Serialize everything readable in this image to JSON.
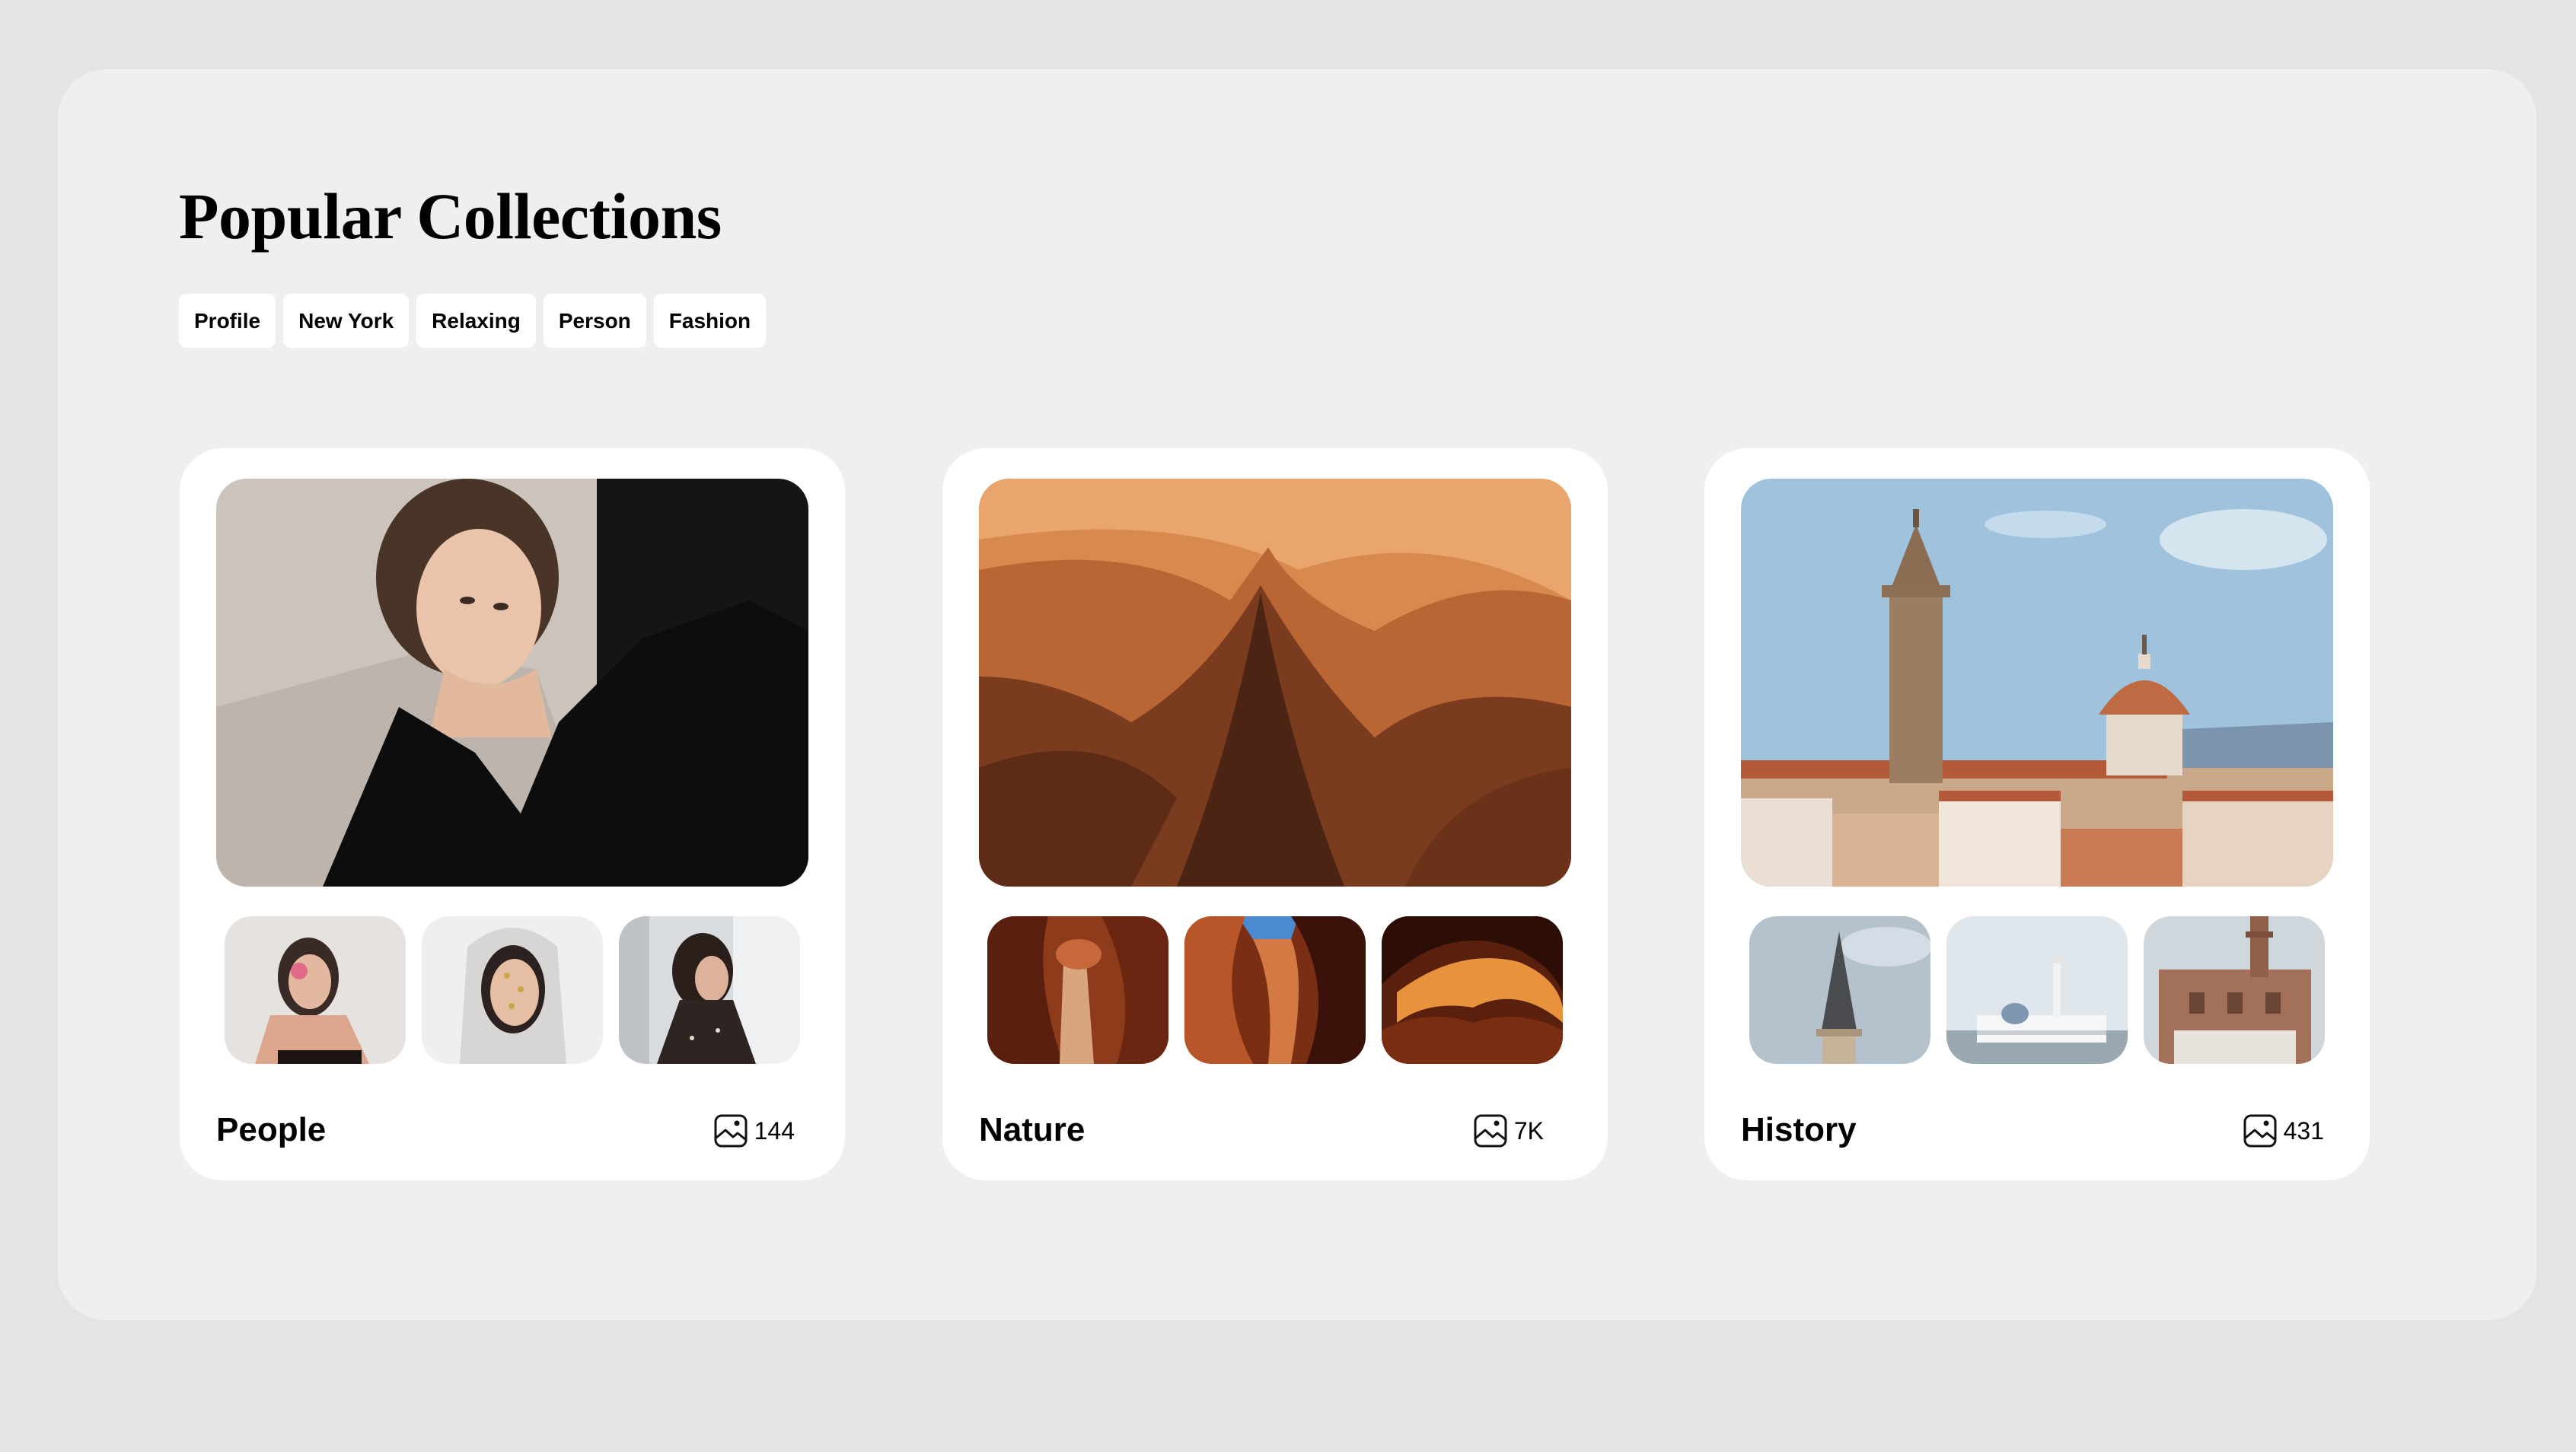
{
  "page": {
    "title": "Popular Collections"
  },
  "tags": [
    "Profile",
    "New York",
    "Relaxing",
    "Person",
    "Fashion"
  ],
  "collections": [
    {
      "name": "People",
      "count": "144"
    },
    {
      "name": "Nature",
      "count": "7K"
    },
    {
      "name": "History",
      "count": "431"
    }
  ],
  "icons": {
    "count": "image-icon"
  },
  "colors": {
    "page_background": "#e4e4e5",
    "panel_background": "#eeeff1",
    "card_background": "#ffffff",
    "text": "#000000"
  }
}
